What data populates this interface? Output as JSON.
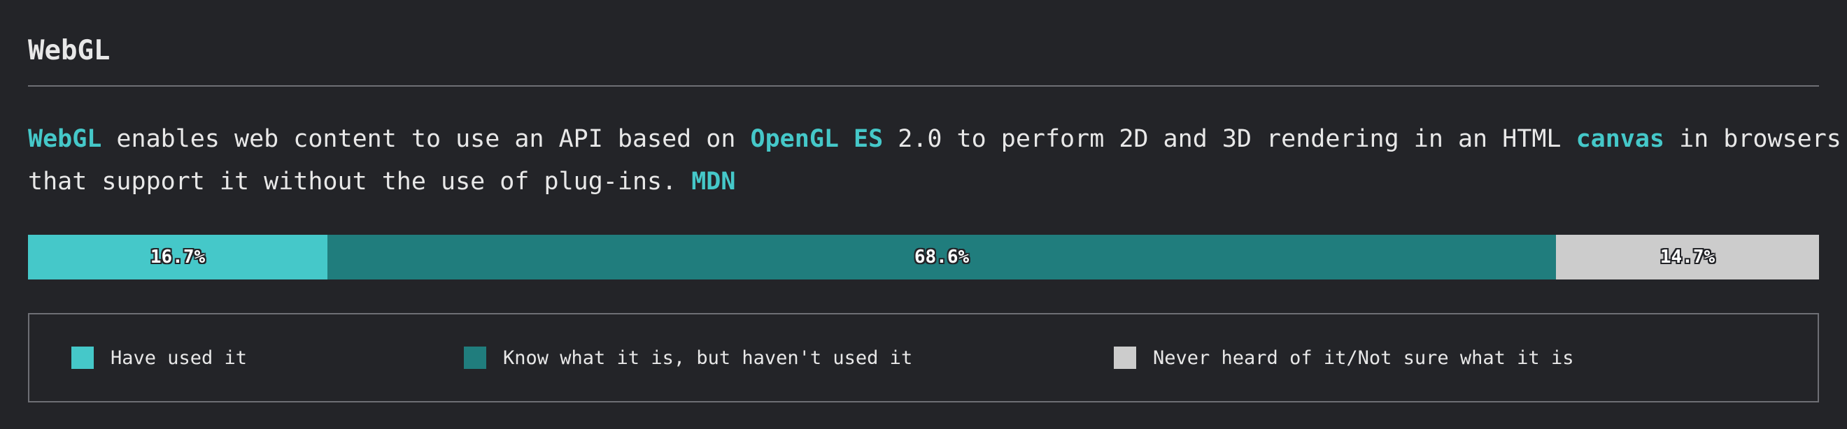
{
  "section": {
    "title": "WebGL",
    "description": [
      {
        "text": "WebGL",
        "highlight": true
      },
      {
        "text": " enables web content to use an API based on ",
        "highlight": false
      },
      {
        "text": "OpenGL ES",
        "highlight": true
      },
      {
        "text": " 2.0 to perform 2D and 3D rendering in an HTML ",
        "highlight": false
      },
      {
        "text": "canvas",
        "highlight": true
      },
      {
        "text": " in browsers",
        "highlight": false
      },
      {
        "text": "\n",
        "highlight": false
      },
      {
        "text": "that support it without the use of plug-ins. ",
        "highlight": false
      },
      {
        "text": "MDN",
        "highlight": true
      }
    ]
  },
  "colors": {
    "background": "#232428",
    "accent": "#45c8c9",
    "used": "#45c8c9",
    "known": "#207d7d",
    "never": "#cccccc",
    "text": "#e8e8e8",
    "border": "#6e6f75"
  },
  "chart_data": {
    "type": "bar",
    "stacked": true,
    "orientation": "horizontal",
    "categories": [
      "Have used it",
      "Know what it is, but haven't used it",
      "Never heard of it/Not sure what it is"
    ],
    "values": [
      16.7,
      68.6,
      14.7
    ],
    "value_labels": [
      "16.7%",
      "68.6%",
      "14.7%"
    ],
    "legend_placement": "bottom",
    "grid": false
  }
}
